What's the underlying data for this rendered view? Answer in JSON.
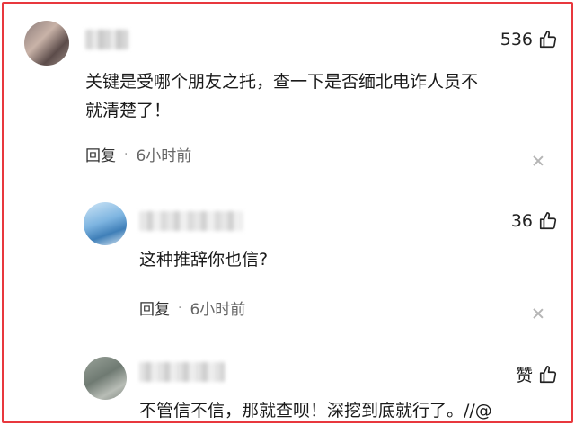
{
  "comments": [
    {
      "likes": "536",
      "text_line1": "关键是受哪个朋友之托，查一下是否缅北电诈人员不",
      "text_line2": "就清楚了！",
      "reply_label": "回复",
      "separator": "·",
      "time": "6小时前"
    },
    {
      "likes": "36",
      "text": "这种推辞你也信?",
      "reply_label": "回复",
      "separator": "·",
      "time": "6小时前"
    },
    {
      "likes": "赞",
      "text": "不管信不信，那就查呗！深挖到底就行了。//@"
    }
  ],
  "colors": {
    "frame_border": "#e8383d",
    "meta_text": "#333333"
  },
  "icons": [
    "thumbs-up-icon",
    "close-icon"
  ]
}
